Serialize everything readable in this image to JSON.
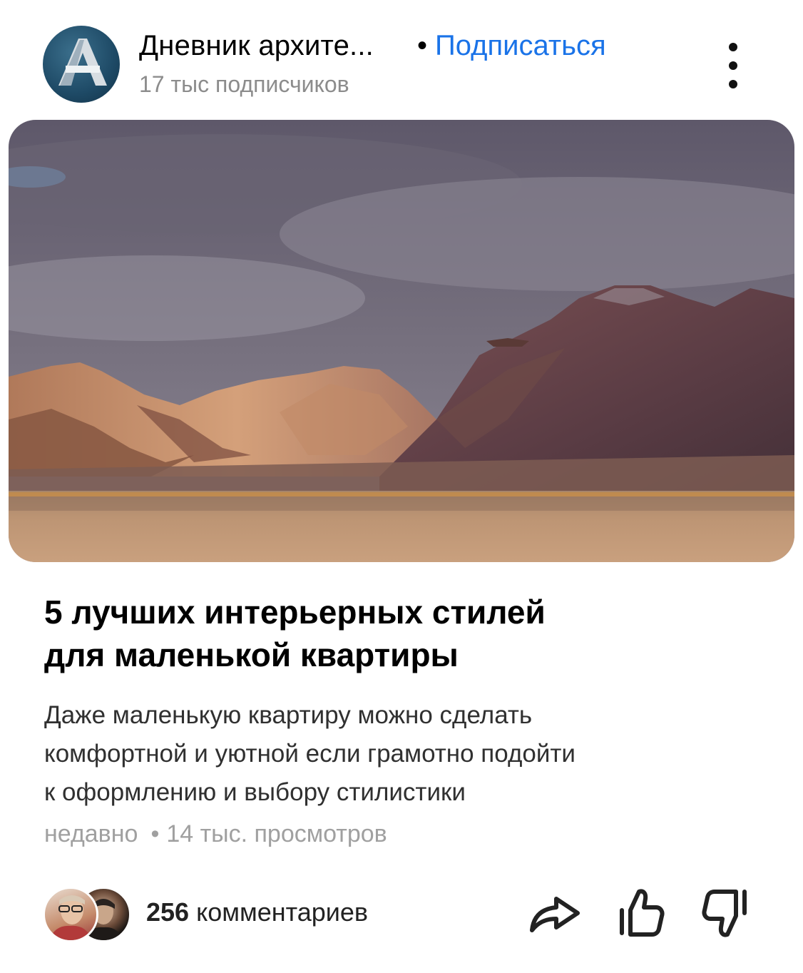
{
  "channel": {
    "name": "Дневник архите...",
    "separator": "•",
    "subscribe_label": "Подписаться",
    "subscribers": "17 тыс подписчиков",
    "avatar_letter": "A"
  },
  "article": {
    "title_line1": "5 лучших интерьерных стилей",
    "title_line2": "для маленькой квартиры",
    "desc_line1": "Даже маленькую квартиру можно сделать",
    "desc_line2": "комфортной и уютной если грамотно подойти",
    "desc_line3": "к оформлению и выбору стилистики",
    "time": "недавно",
    "separator": "•",
    "views": "14 тыс. просмотров"
  },
  "footer": {
    "comments_count": "256",
    "comments_label": "комментариев"
  },
  "icons": {
    "more": "more-vertical-icon",
    "share": "share-icon",
    "like": "thumbs-up-icon",
    "dislike": "thumbs-down-icon"
  },
  "colors": {
    "accent": "#1a73e8",
    "secondary_text": "#8c8c8c"
  }
}
